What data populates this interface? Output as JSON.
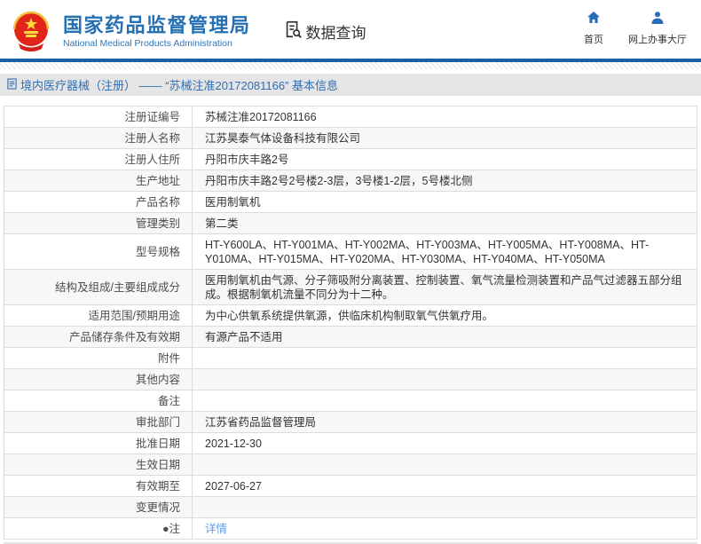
{
  "header": {
    "site_title_zh": "国家药品监督管理局",
    "site_title_en": "National Medical Products Administration",
    "section_title": "数据查询",
    "nav": [
      {
        "icon": "home-icon",
        "label": "首页"
      },
      {
        "icon": "user-icon",
        "label": "网上办事大厅"
      }
    ]
  },
  "page": {
    "breadcrumb": "境内医疗器械（注册） —— “苏械注准20172081166” 基本信息"
  },
  "table": {
    "rows": [
      {
        "label": "注册证编号",
        "value": "苏械注准20172081166"
      },
      {
        "label": "注册人名称",
        "value": "江苏昊泰气体设备科技有限公司"
      },
      {
        "label": "注册人住所",
        "value": "丹阳市庆丰路2号"
      },
      {
        "label": "生产地址",
        "value": "丹阳市庆丰路2号2号楼2-3层，3号楼1-2层，5号楼北侧"
      },
      {
        "label": "产品名称",
        "value": "医用制氧机"
      },
      {
        "label": "管理类别",
        "value": "第二类"
      },
      {
        "label": "型号规格",
        "value": "HT-Y600LA、HT-Y001MA、HT-Y002MA、HT-Y003MA、HT-Y005MA、HT-Y008MA、HT-Y010MA、HT-Y015MA、HT-Y020MA、HT-Y030MA、HT-Y040MA、HT-Y050MA"
      },
      {
        "label": "结构及组成/主要组成成分",
        "value": "医用制氧机由气源、分子筛吸附分离装置、控制装置、氧气流量检测装置和产品气过滤器五部分组成。根据制氧机流量不同分为十二种。"
      },
      {
        "label": "适用范围/预期用途",
        "value": "为中心供氧系统提供氧源，供临床机构制取氧气供氧疗用。"
      },
      {
        "label": "产品储存条件及有效期",
        "value": "有源产品不适用"
      },
      {
        "label": "附件",
        "value": ""
      },
      {
        "label": "其他内容",
        "value": ""
      },
      {
        "label": "备注",
        "value": ""
      },
      {
        "label": "审批部门",
        "value": "江苏省药品监督管理局"
      },
      {
        "label": "批准日期",
        "value": "2021-12-30"
      },
      {
        "label": "生效日期",
        "value": ""
      },
      {
        "label": "有效期至",
        "value": "2027-06-27"
      },
      {
        "label": "变更情况",
        "value": ""
      },
      {
        "label": "●注",
        "value": "详情",
        "link": true
      }
    ]
  },
  "colors": {
    "brand_blue": "#2470b3",
    "rule_blue": "#1d5fa5",
    "link_blue": "#5b9df1",
    "emblem_red": "#e12619",
    "breadcrumb_bg": "#e5e5e5"
  }
}
